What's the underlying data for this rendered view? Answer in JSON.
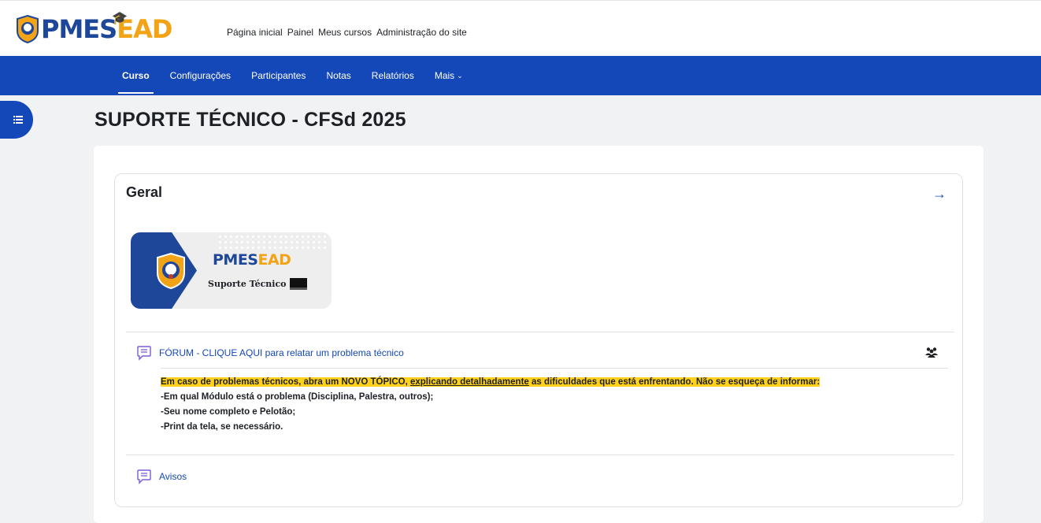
{
  "header": {
    "logo_alt": "PMES EAD",
    "nav": [
      "Página inicial",
      "Painel",
      "Meus cursos",
      "Administração do site"
    ]
  },
  "secondary_nav": {
    "items": [
      "Curso",
      "Configurações",
      "Participantes",
      "Notas",
      "Relatórios",
      "Mais"
    ],
    "active": "Curso"
  },
  "page": {
    "title": "SUPORTE TÉCNICO - CFSd 2025"
  },
  "section": {
    "title": "Geral",
    "banner": {
      "logo_pm": "PMES",
      "logo_ead": "EAD",
      "subtitle": "Suporte Técnico"
    },
    "activities": [
      {
        "label": "FÓRUM - CLIQUE AQUI para relatar um problema técnico",
        "icon": "forum-icon"
      },
      {
        "label": "Avisos",
        "icon": "forum-icon"
      }
    ],
    "description": {
      "line1_a": "Em caso de problemas técnicos, abra um NOVO TÓPICO, ",
      "line1_u": "explicando detalhadamente",
      "line1_b": " as dificuldades que está enfrentando. Não se esqueça de informar:",
      "line2": "-Em qual Módulo está o problema (Disciplina, Palestra, outros);",
      "line3": "-Seu nome completo e Pelotão;",
      "line4": "-Print da tela, se necessário."
    }
  },
  "colors": {
    "primary": "#1447b8",
    "brand_blue": "#1e4799",
    "brand_orange": "#f2a316",
    "highlight": "#ffd11c"
  }
}
